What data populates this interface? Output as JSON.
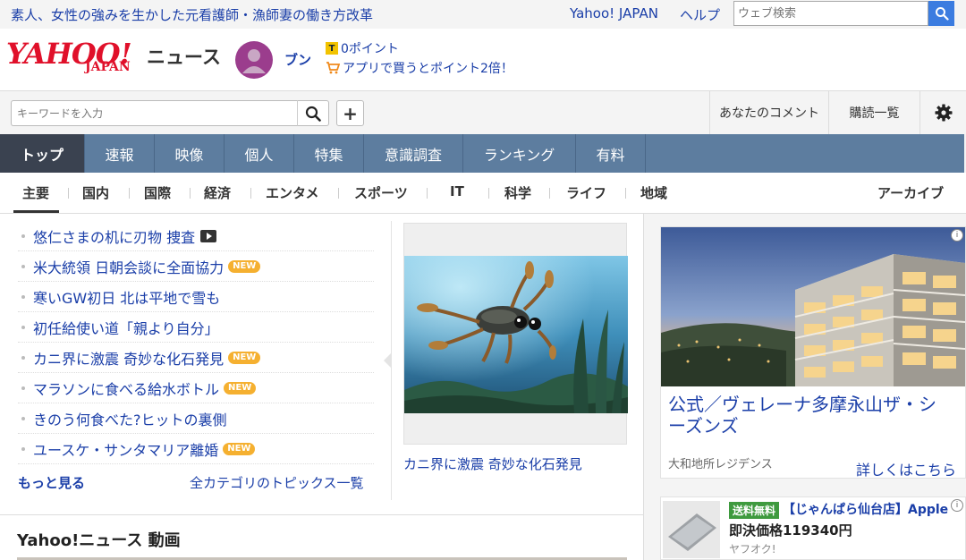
{
  "topbar": {
    "promo": "素人、女性の強みを生かした元看護師・漁師妻の働き方改革",
    "yahoo_japan_link": "Yahoo! JAPAN",
    "help_link": "ヘルプ",
    "web_search_placeholder": "ウェブ検索"
  },
  "header": {
    "logo_main": "YAHOO!",
    "logo_sub": "JAPAN",
    "service_name": "ニュース",
    "username": "ブン",
    "points": "0ポイント",
    "app_promo": "アプリで買うとポイント2倍！"
  },
  "search": {
    "keyword_placeholder": "キーワードを入力",
    "plus_label": "+",
    "comments_link": "あなたのコメント",
    "subscriptions_link": "購読一覧"
  },
  "nav": {
    "tabs": [
      {
        "label": "トップ"
      },
      {
        "label": "速報"
      },
      {
        "label": "映像"
      },
      {
        "label": "個人"
      },
      {
        "label": "特集"
      },
      {
        "label": "意識調査"
      },
      {
        "label": "ランキング"
      },
      {
        "label": "有料"
      }
    ]
  },
  "categories": {
    "items": [
      "主要",
      "国内",
      "国際",
      "経済",
      "エンタメ",
      "スポーツ",
      "IT",
      "科学",
      "ライフ",
      "地域"
    ],
    "archive": "アーカイブ"
  },
  "topics": {
    "items": [
      {
        "title": "悠仁さまの机に刃物 捜査"
      },
      {
        "title": "米大統領 日朝会談に全面協力",
        "badge": "NEW"
      },
      {
        "title": "寒いGW初日 北は平地で雪も"
      },
      {
        "title": "初任給使い道「親より自分」"
      },
      {
        "title": "カニ界に激震 奇妙な化石発見",
        "badge": "NEW"
      },
      {
        "title": "マラソンに食べる給水ボトル",
        "badge": "NEW"
      },
      {
        "title": "きのう何食べた?ヒットの裏側"
      },
      {
        "title": "ユースケ・サンタマリア離婚",
        "badge": "NEW"
      }
    ],
    "more": "もっと見る",
    "all_categories": "全カテゴリのトピックス一覧"
  },
  "pickup": {
    "caption": "カニ界に激震 奇妙な化石発見"
  },
  "video_section": {
    "title": "Yahoo!ニュース 動画"
  },
  "ads": {
    "ad1": {
      "title": "公式／ヴェレーナ多摩永山ザ・シーズンズ",
      "sponsor": "大和地所レジデンス",
      "cta": "詳しくはこちら",
      "info_icon": "i"
    },
    "ad2": {
      "free_shipping": "送料無料",
      "shop": "【じゃんぱら仙台店】Apple",
      "price": "即決価格119340円",
      "source": "ヤフオク!",
      "info_icon": "i"
    }
  },
  "colors": {
    "link": "#1a3ea8",
    "brand_red": "#e0102a",
    "nav_bg": "#5d7d9f",
    "nav_active": "#3a4250",
    "new_badge": "#f5b030"
  }
}
